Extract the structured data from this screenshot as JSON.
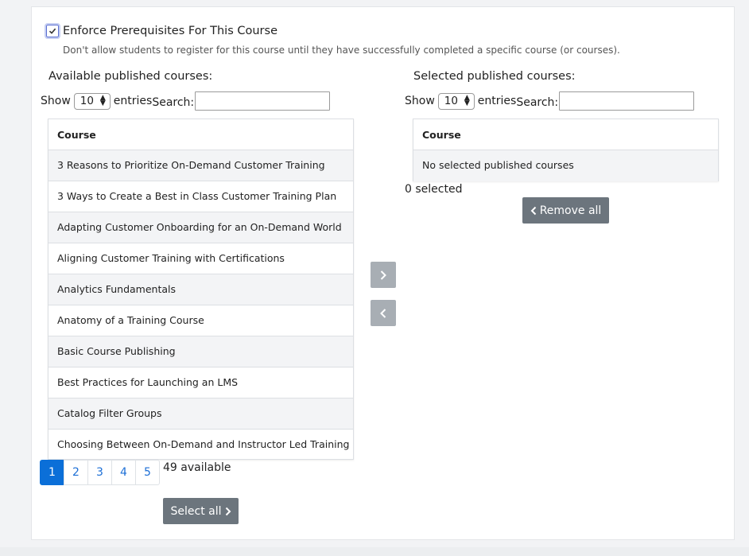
{
  "prerequisites": {
    "checked": true,
    "label": "Enforce Prerequisites For This Course",
    "help": "Don't allow students to register for this course until they have successfully completed a specific course (or courses)."
  },
  "available": {
    "title": "Available published courses:",
    "show_label": "Show",
    "page_size": "10",
    "entries_label": "entries",
    "search_label": "Search:",
    "search_value": "",
    "column_header": "Course",
    "rows": [
      "3 Reasons to Prioritize On-Demand Customer Training",
      "3 Ways to Create a Best in Class Customer Training Plan",
      "Adapting Customer Onboarding for an On-Demand World",
      "Aligning Customer Training with Certifications",
      "Analytics Fundamentals",
      "Anatomy of a Training Course",
      "Basic Course Publishing",
      "Best Practices for Launching an LMS",
      "Catalog Filter Groups",
      "Choosing Between On-Demand and Instructor Led Training"
    ],
    "pages": [
      "1",
      "2",
      "3",
      "4",
      "5"
    ],
    "active_page": "1",
    "count_text": "49 available",
    "select_all_label": "Select all"
  },
  "selected": {
    "title": "Selected published courses:",
    "show_label": "Show",
    "page_size": "10",
    "entries_label": "entries",
    "search_label": "Search:",
    "search_value": "",
    "column_header": "Course",
    "empty_text": "No selected published courses",
    "count_text": "0 selected",
    "remove_all_label": "Remove all"
  },
  "colors": {
    "accent": "#0b6fd8",
    "button_dark": "#6c757d",
    "button_light": "#a8aeb4"
  }
}
